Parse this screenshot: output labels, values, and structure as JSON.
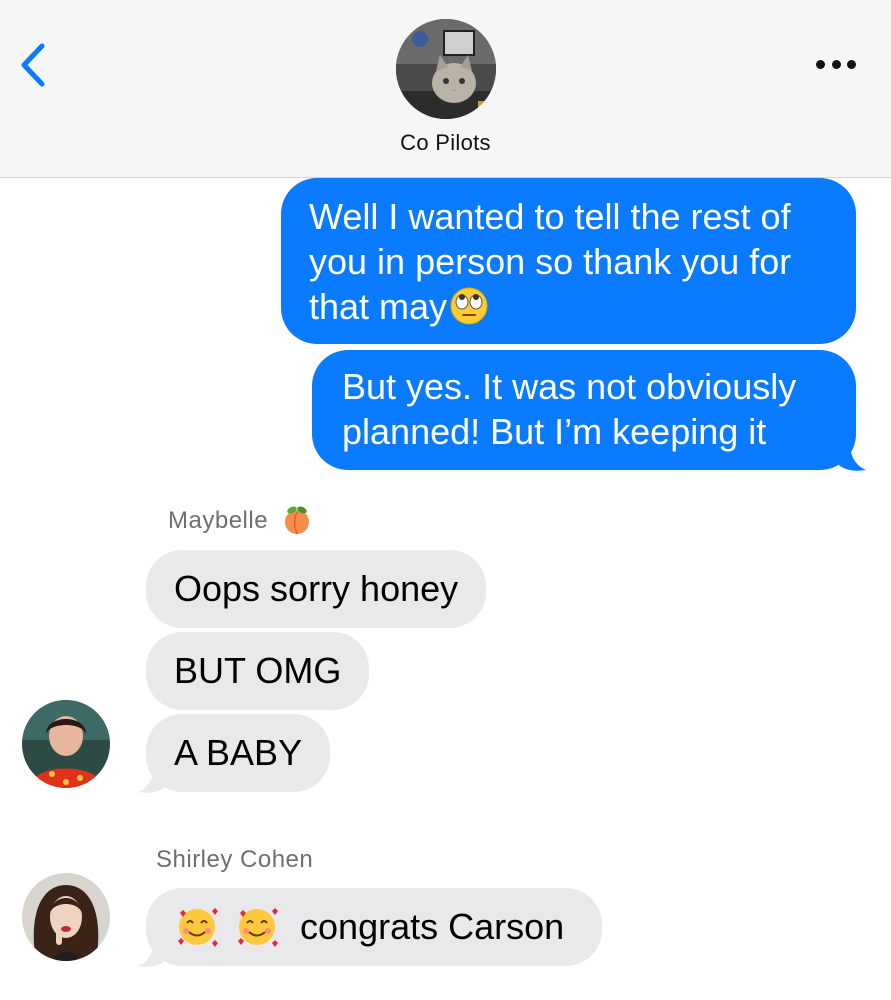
{
  "header": {
    "group_name": "Co Pilots",
    "back_icon": "chevron-left-icon",
    "more_icon": "ellipsis-icon",
    "accent_color": "#0a7bff"
  },
  "messages": {
    "out1": {
      "text": "Well I wanted to tell the rest of you in person so thank you for that may",
      "emoji": "face-with-rolling-eyes"
    },
    "out2": {
      "text": "But yes. It was not obviously planned! But I’m keeping it"
    },
    "maybelle": {
      "sender": "Maybelle",
      "sender_emoji": "peach",
      "m1": "Oops sorry honey",
      "m2": "BUT OMG",
      "m3": "A BABY"
    },
    "shirley": {
      "sender": "Shirley Cohen",
      "text": "congrats Carson",
      "emoji": "smiling-face-with-hearts"
    }
  }
}
